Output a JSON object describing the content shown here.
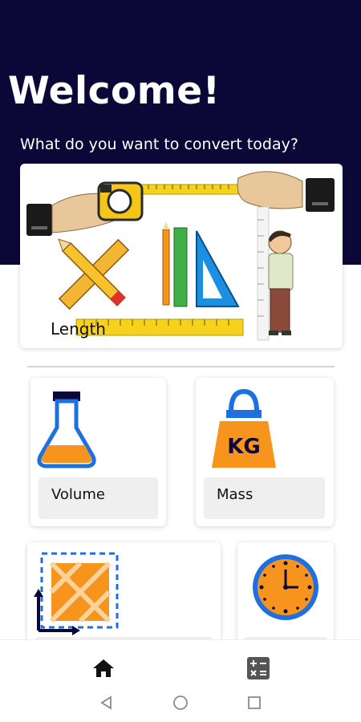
{
  "header": {
    "title": "Welcome!",
    "subtitle": "What do you want to convert today?"
  },
  "categories": [
    {
      "label": "Length",
      "icon": "ruler-measuring-tape-icon"
    },
    {
      "label": "Volume",
      "icon": "flask-icon"
    },
    {
      "label": "Mass",
      "icon": "kg-weight-icon"
    },
    {
      "label": "",
      "icon": "area-icon"
    },
    {
      "label": "",
      "icon": "clock-icon"
    }
  ],
  "bottom_nav": {
    "items": [
      {
        "icon": "home-icon",
        "active": true
      },
      {
        "icon": "calculator-icon",
        "active": false
      }
    ]
  },
  "system_nav": [
    "back-icon",
    "home-circle-icon",
    "recents-icon"
  ],
  "colors": {
    "header_bg": "#0b0838",
    "accent_orange": "#f7941d",
    "accent_blue": "#1e6fe0",
    "card_label_bg": "#efefef"
  }
}
